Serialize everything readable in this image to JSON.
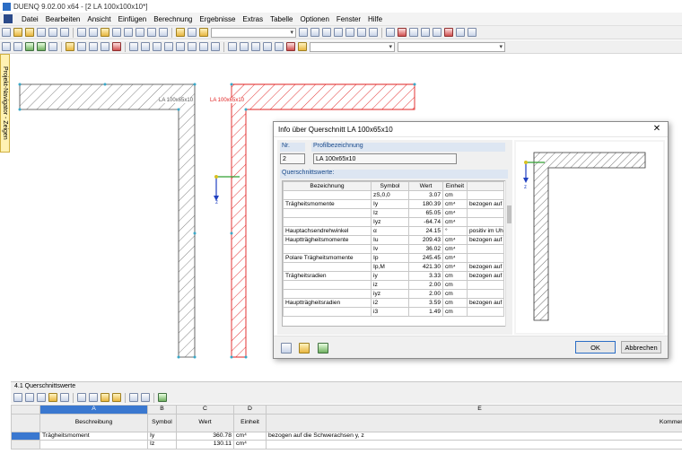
{
  "window": {
    "title": "DUENQ 9.02.00 x64 - [2 LA 100x100x10*]"
  },
  "menu": {
    "items": [
      "Datei",
      "Bearbeiten",
      "Ansicht",
      "Einfügen",
      "Berechnung",
      "Ergebnisse",
      "Extras",
      "Tabelle",
      "Optionen",
      "Fenster",
      "Hilfe"
    ]
  },
  "sidebar": {
    "navigator_tab": "Projekt-Navigator - Zeigen"
  },
  "canvas": {
    "label_gray": "LA 100x65x10",
    "label_red": "LA 100x65x10",
    "axis_label": "z"
  },
  "dialog": {
    "title": "Info über Querschnitt LA 100x65x10",
    "nr_label": "Nr.",
    "nr_value": "2",
    "profile_label": "Profilbezeichnung",
    "profile_value": "LA 100x65x10",
    "section_label": "Querschnittswerte:",
    "headers": [
      "Bezeichnung",
      "Symbol",
      "Wert",
      "Einheit",
      ""
    ],
    "rows": [
      [
        "",
        "zS,0,0",
        "3.07",
        "cm",
        ""
      ],
      [
        "Trägheitsmomente",
        "Iy",
        "180.39",
        "cm⁴",
        "bezogen auf"
      ],
      [
        "",
        "Iz",
        "65.05",
        "cm⁴",
        ""
      ],
      [
        "",
        "Iyz",
        "-64.74",
        "cm⁴",
        ""
      ],
      [
        "Hauptachsendrehwinkel",
        "α",
        "24.15",
        "°",
        "positiv im Uhr"
      ],
      [
        "Hauptträgheitsmomente",
        "Iu",
        "209.43",
        "cm⁴",
        "bezogen auf"
      ],
      [
        "",
        "Iv",
        "36.02",
        "cm⁴",
        ""
      ],
      [
        "Polare Trägheitsmomente",
        "Ip",
        "245.45",
        "cm⁴",
        ""
      ],
      [
        "",
        "Ip,M",
        "421.30",
        "cm⁴",
        "bezogen auf"
      ],
      [
        "Trägheitsradien",
        "iy",
        "3.33",
        "cm",
        "bezogen auf"
      ],
      [
        "",
        "iz",
        "2.00",
        "cm",
        ""
      ],
      [
        "",
        "iyz",
        "2.00",
        "cm",
        ""
      ],
      [
        "Hauptträgheitsradien",
        "i2",
        "3.59",
        "cm",
        "bezogen auf"
      ],
      [
        "",
        "i3",
        "1.49",
        "cm",
        ""
      ]
    ],
    "preview_axis": "z",
    "ok_label": "OK",
    "cancel_label": "Abbrechen"
  },
  "bottom_panel": {
    "title": "4.1 Querschnittswerte",
    "col_letters": [
      "A",
      "B",
      "C",
      "D",
      "E"
    ],
    "col_names": [
      "Beschreibung",
      "Symbol",
      "Wert",
      "Einheit",
      "Kommentar"
    ],
    "rows": [
      [
        "Trägheitsmoment",
        "Iy",
        "360.78",
        "cm⁴",
        "bezogen auf die Schwerachsen y, z"
      ],
      [
        "",
        "Iz",
        "130.11",
        "cm⁴",
        ""
      ]
    ]
  },
  "colors": {
    "accent": "#3a78d0",
    "section_red": "#e02020",
    "section_gray": "#555555"
  }
}
